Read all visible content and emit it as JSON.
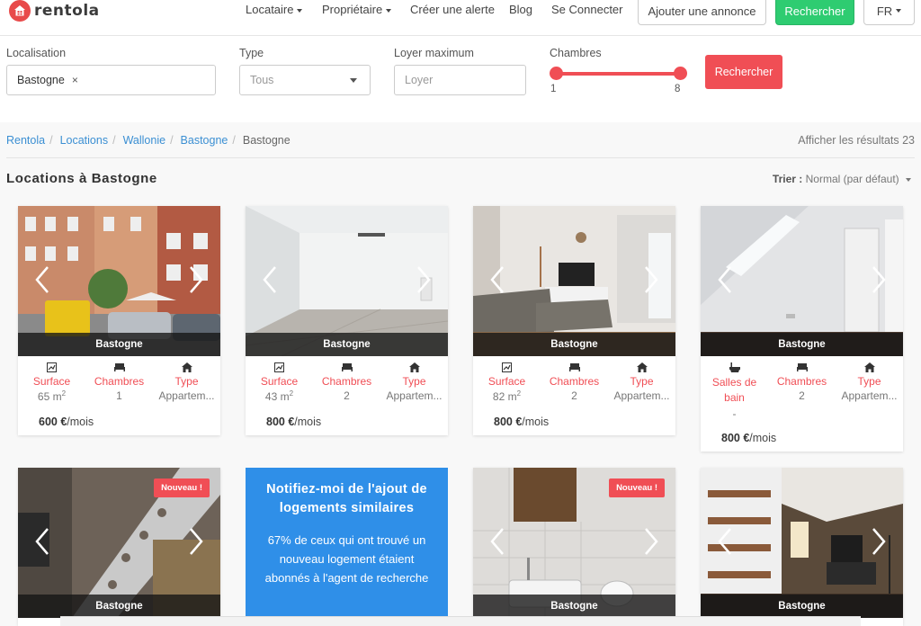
{
  "brand": {
    "name": "rentola"
  },
  "nav": {
    "links": [
      {
        "label": "Locataire",
        "caret": true
      },
      {
        "label": "Propriétaire",
        "caret": true
      },
      {
        "label": "Créer une alerte"
      },
      {
        "label": "Blog"
      },
      {
        "label": "Se Connecter"
      }
    ],
    "add_listing": "Ajouter une annonce",
    "search": "Rechercher",
    "lang": "FR"
  },
  "filters": {
    "location": {
      "label": "Localisation",
      "value": "Bastogne",
      "remove": "×"
    },
    "type": {
      "label": "Type",
      "value": "Tous"
    },
    "max_rent": {
      "label": "Loyer maximum",
      "placeholder": "Loyer"
    },
    "rooms": {
      "label": "Chambres",
      "min": "1",
      "max": "8"
    },
    "submit": "Rechercher"
  },
  "breadcrumb": [
    "Rentola",
    "Locations",
    "Wallonie",
    "Bastogne",
    "Bastogne"
  ],
  "results_count": "Afficher les résultats 23",
  "heading": "Locations à Bastogne",
  "sort": {
    "label": "Trier :",
    "value": "Normal (par défaut)"
  },
  "colors": {
    "accent": "#f04e55",
    "green": "#2ecc71",
    "link": "#3b8fd3",
    "promo": "#2f8fe8"
  },
  "listings": [
    {
      "city": "Bastogne",
      "specs": [
        {
          "label": "Surface",
          "value": "65 m",
          "sup": "2",
          "icon": "area-icon"
        },
        {
          "label": "Chambres",
          "value": "1",
          "icon": "bed-icon"
        },
        {
          "label": "Type",
          "value": "Appartem...",
          "icon": "home-icon"
        }
      ],
      "price": "600 €",
      "per": "/mois"
    },
    {
      "city": "Bastogne",
      "specs": [
        {
          "label": "Surface",
          "value": "43 m",
          "sup": "2",
          "icon": "area-icon"
        },
        {
          "label": "Chambres",
          "value": "2",
          "icon": "bed-icon"
        },
        {
          "label": "Type",
          "value": "Appartem...",
          "icon": "home-icon"
        }
      ],
      "price": "800 €",
      "per": "/mois"
    },
    {
      "city": "Bastogne",
      "specs": [
        {
          "label": "Surface",
          "value": "82 m",
          "sup": "2",
          "icon": "area-icon"
        },
        {
          "label": "Chambres",
          "value": "2",
          "icon": "bed-icon"
        },
        {
          "label": "Type",
          "value": "Appartem...",
          "icon": "home-icon"
        }
      ],
      "price": "800 €",
      "per": "/mois"
    },
    {
      "city": "Bastogne",
      "specs": [
        {
          "label": "Salles de bain",
          "value": "-",
          "icon": "bath-icon"
        },
        {
          "label": "Chambres",
          "value": "2",
          "icon": "bed-icon"
        },
        {
          "label": "Type",
          "value": "Appartem...",
          "icon": "home-icon"
        }
      ],
      "price": "800 €",
      "per": "/mois"
    },
    {
      "city": "Bastogne",
      "badge": "Nouveau !"
    },
    {
      "city": "Bastogne",
      "badge": "Nouveau !"
    },
    {
      "city": "Bastogne"
    }
  ],
  "promo": {
    "title": "Notifiez-moi de l'ajout de logements similaires",
    "text": "67% de ceux qui ont trouvé un nouveau logement étaient abonnés à l'agent de recherche"
  }
}
